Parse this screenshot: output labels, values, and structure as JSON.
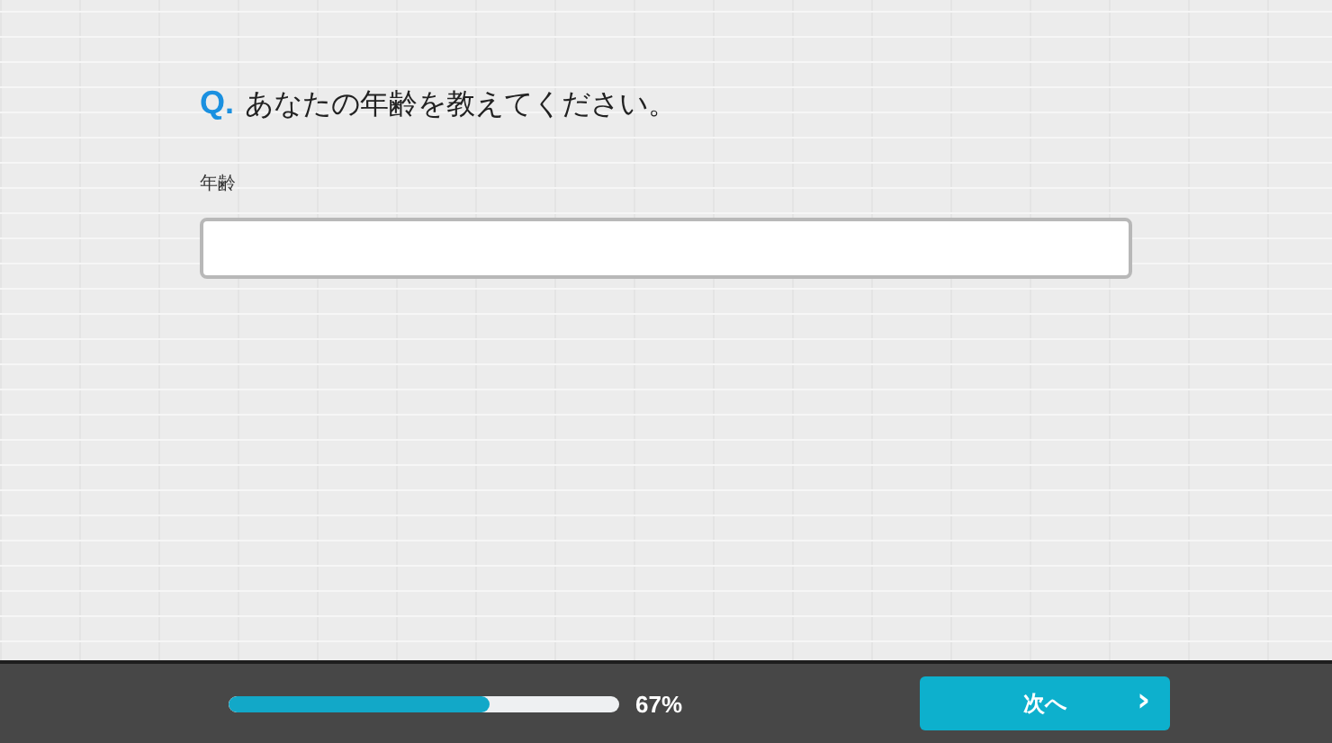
{
  "question": {
    "prefix": "Q.",
    "text": "あなたの年齢を教えてください。"
  },
  "field": {
    "label": "年齢"
  },
  "progress": {
    "level": 0.67,
    "reading": "67%"
  },
  "next_button": {
    "label": "次へ",
    "chevron": "›"
  }
}
